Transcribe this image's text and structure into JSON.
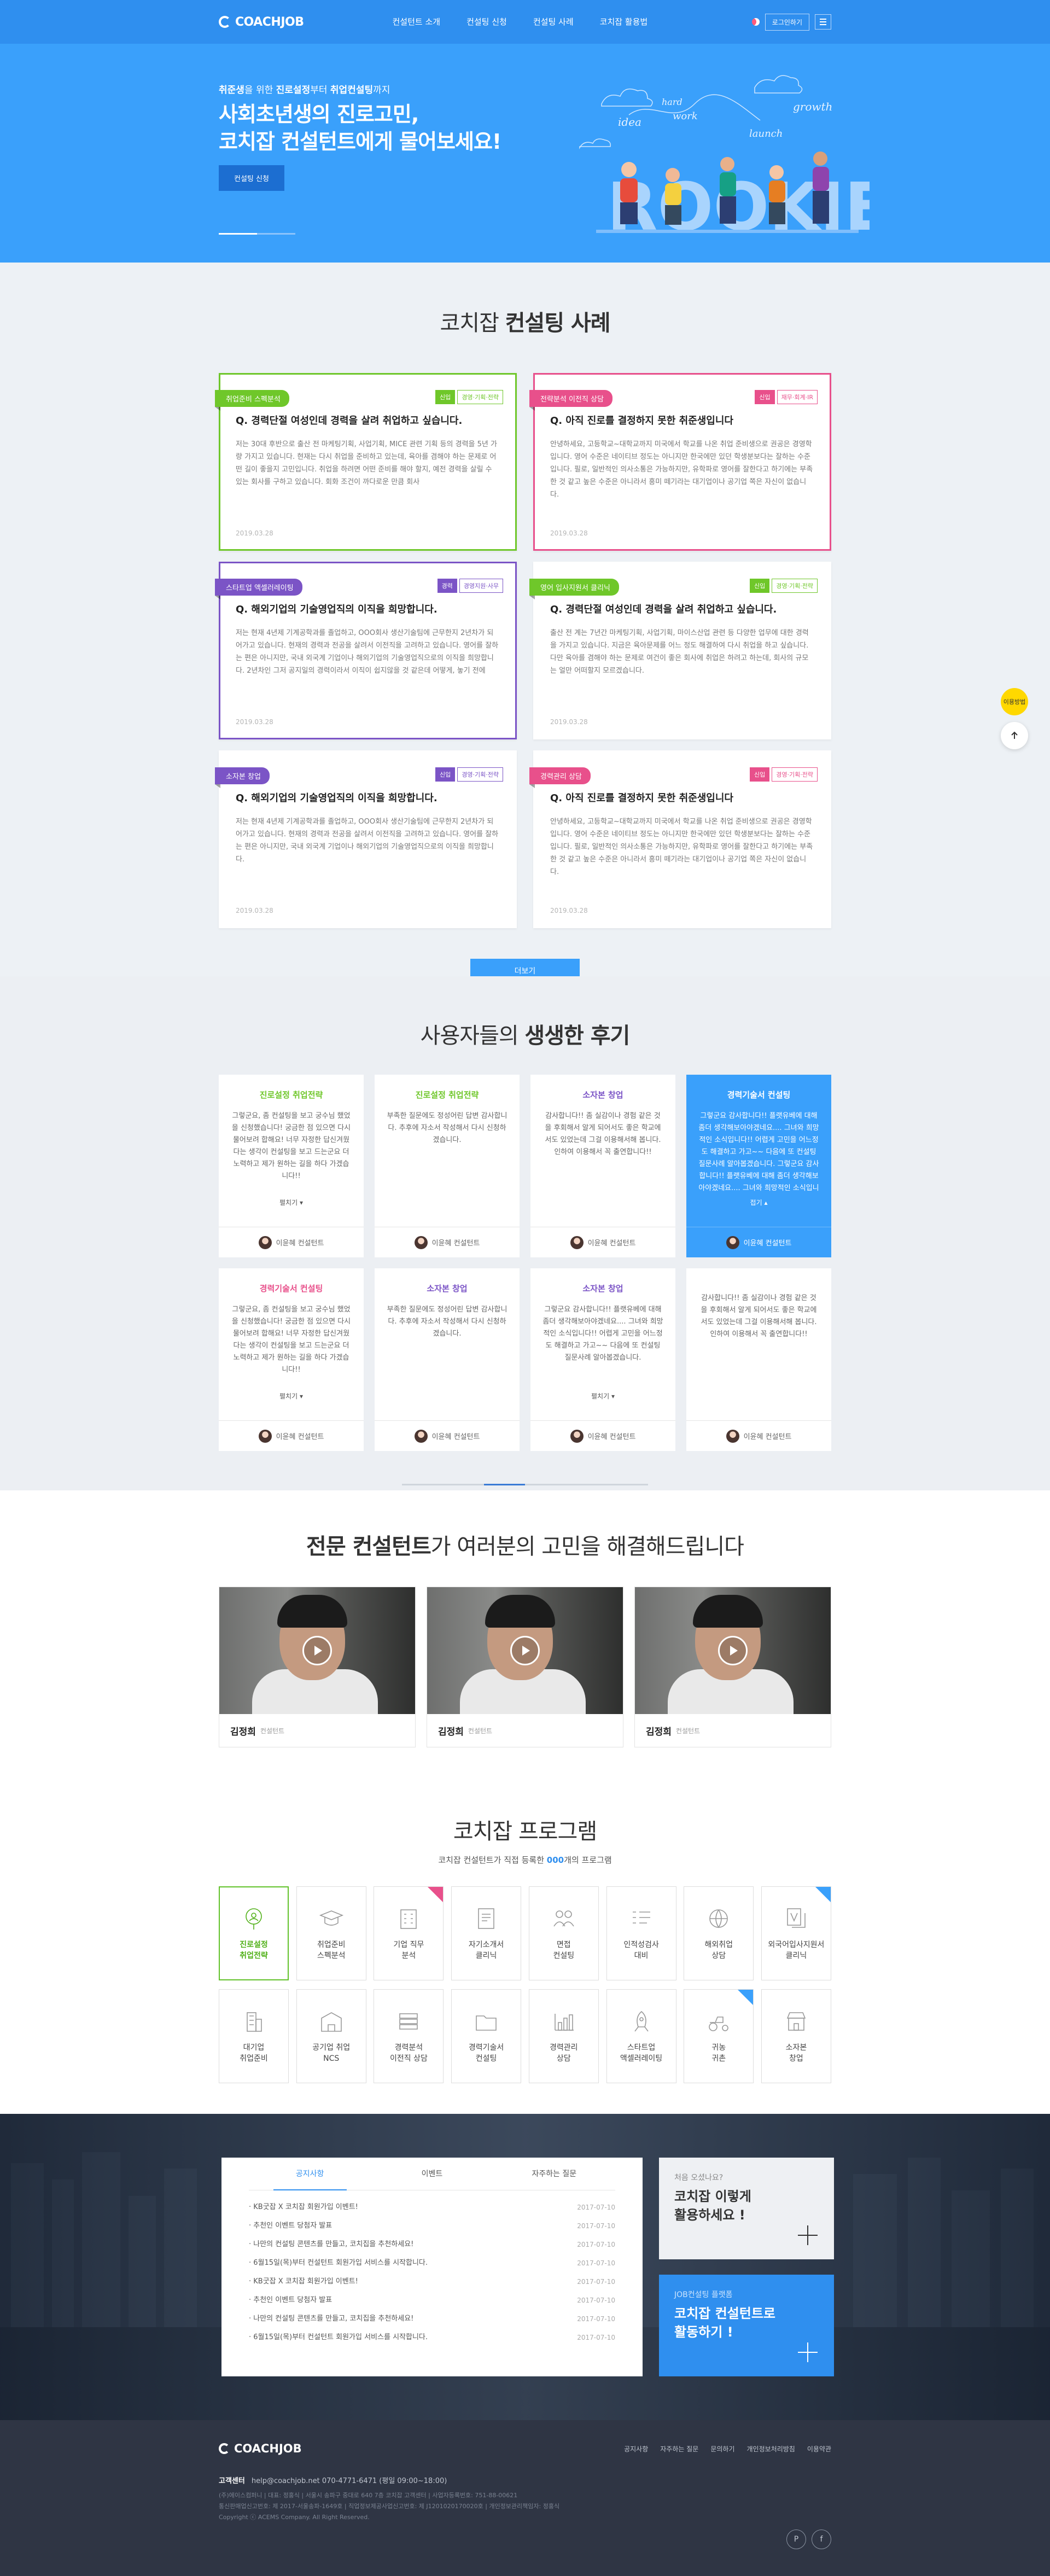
{
  "header": {
    "logo": "COACHJOB",
    "nav": [
      "컨설턴트 소개",
      "컨설팅 신청",
      "컨설팅 사례",
      "코치잡 활용법"
    ],
    "login": "로그인하기"
  },
  "hero": {
    "sub_pre": "취준생",
    "sub_mid1": "을 위한 ",
    "sub_b2": "진로설정",
    "sub_mid2": "부터 ",
    "sub_b3": "취업컨설팅",
    "sub_post": "까지",
    "title_line1": "사회초년생의 진로고민,",
    "title_line2": "코치잡 컨설턴트에게 물어보세요!",
    "button": "컨설팅 신청",
    "art_words": [
      "idea",
      "hard",
      "work",
      "growth",
      "launch"
    ],
    "art_big": "ROOKIE",
    "slide_active": 1,
    "slide_count": 3
  },
  "cases": {
    "title_pre": "코치잡 ",
    "title_b": "컨설팅 사례",
    "more": "더보기",
    "items": [
      {
        "tag": "취업준비 스펙분석",
        "color": "green",
        "bordered": true,
        "badges": [
          "신입",
          "경영·기획·전략"
        ],
        "q": "Q. 경력단절 여성인데 경력을 살려 취업하고 싶습니다.",
        "body": "저는 30대 후반으로 출산 전 마케팅기획, 사업기획, MICE 관련 기획 등의 경력을 5년 가량 가지고 있습니다. 현재는 다시 취업을 준비하고 있는데, 육아를 겸해야 하는 문제로 어떤 길이 좋을지 고민입니다. 취업을 하려면 어떤 준비를 해야 할지, 예전 경력을 살릴 수 있는 회사를 구하고 있습니다. 회화 조건이 까다로운 만큼 회사",
        "date": "2019.03.28"
      },
      {
        "tag": "전략분석 이전직 상담",
        "color": "pink",
        "bordered": true,
        "badges": [
          "신입",
          "재무·회계·IR"
        ],
        "q": "Q. 아직 진로를 결정하지 못한 취준생입니다",
        "body": "안녕하세요, 고등학교~대학교까지 미국에서 학교를 나온 취업 준비생으로 권공은 경영학입니다. 영어 수준은 네이티브 정도는 아니지만 한국에만 있던 학생분보다는 잘하는 수준입니다. 필로, 일반적인 의사소통은 가능하지만, 유학파로 영어를 잘한다고 하기에는 부족한 것 같고 높은 수준은 아니라서 흥미 떼기라는 대기업이나 공기업 쪽은 자신이 없습니다.",
        "date": "2019.03.28"
      },
      {
        "tag": "스타트업 액셀러레이팅",
        "color": "purple",
        "bordered": true,
        "badges": [
          "경력",
          "경영지원·사무"
        ],
        "q": "Q. 해외기업의 기술영업직의 이직을 희망합니다.",
        "body": "저는 현재 4년제 기계공학과를 졸업하고, OOO회사 생산기술팀에 근무한지 2년차가 되어가고 있습니다. 현재의 경력과 전공을 살려서 이전직을 고려하고 있습니다. 영어를 잘하는 편은 아니지만, 국내 외국계 기업이나 해외기업의 기술영업직으로의 이직을 희망합니다. 2년차인 그저 공지일의 경력이라서 이직이 쉽지않을 것 같은데 어떻게, 놓기 전에",
        "date": "2019.03.28"
      },
      {
        "tag": "영어 입사지원서 클리닉",
        "color": "green",
        "bordered": false,
        "badges": [
          "신입",
          "경영·기획·전략"
        ],
        "q": "Q. 경력단절 여성인데 경력을 살려 취업하고 싶습니다.",
        "body": "출산 전 계는 7년간 마케팅기획, 사업기획, 마이스산업 관련 등 다양한 업무에 대한 경력을 가지고 있습니다. 지금은 육아문제를 어느 정도 해결하여 다시 취업을 하고 싶습니다. 다만 육아를 겸해야 하는 문제로 여건이 좋은 회사에 취업은 하려고 하는데, 회사의 규모는 얼만 어떠할지 모르겠습니다.",
        "date": "2019.03.28"
      },
      {
        "tag": "소자본 창업",
        "color": "purple",
        "bordered": false,
        "badges": [
          "신입",
          "경영·기획·전략"
        ],
        "q": "Q. 해외기업의 기술영업직의 이직을 희망합니다.",
        "body": "저는 현재 4년제 기계공학과를 졸업하고, OOO회사 생산기술팀에 근무한지 2년차가 되어가고 있습니다. 현재의 경력과 전공을 살려서 이전직을 고려하고 있습니다. 영어를 잘하는 편은 아니지만, 국내 외국계 기업이나 해외기업의 기술영업직으로의 이직을 희망합니다.",
        "date": "2019.03.28"
      },
      {
        "tag": "경력관리 상담",
        "color": "pink",
        "bordered": false,
        "badges": [
          "신입",
          "경영·기획·전략"
        ],
        "q": "Q. 아직 진로를 결정하지 못한 취준생입니다",
        "body": "안녕하세요, 고등학교~대학교까지 미국에서 학교를 나온 취업 준비생으로 권공은 경영학입니다. 영어 수준은 네이티브 정도는 아니지만 한국에만 있던 학생분보다는 잘하는 수준입니다. 필로, 일반적인 의사소통은 가능하지만, 유학파로 영어를 잘한다고 하기에는 부족한 것 같고 높은 수준은 아니라서 흥미 떼기라는 대기업이나 공기업 쪽은 자신이 없습니다.",
        "date": "2019.03.28"
      }
    ]
  },
  "reviews": {
    "title_pre": "사용자들의 ",
    "title_b": "생생한 후기",
    "items": [
      {
        "tag": "진로설정 취업전략",
        "tcolor": "#6fc72a",
        "text": "그렇군요, 좀 컨설팅을 보고 궁수님 했었을 신청했습니다! 궁금한 점 있으면 다시 물어보려 합해요! 너무 자정한 답신겨웠다는 생각이 컨설팅을 보고 드는군요 더 노력하고 제가 원하는 길을 하다 가겠습니다!!",
        "more": "펼치기",
        "name": "이윤혜 컨설턴트",
        "blue": false
      },
      {
        "tag": "진로설정 취업전략",
        "tcolor": "#6fc72a",
        "text": "부족한 질문에도 정성어린 답변 감사합니다. 추후에 자소서 작성해서 다시 신청하겠습니다.",
        "more": "",
        "name": "이윤혜 컨설턴트",
        "blue": false
      },
      {
        "tag": "소자본 창업",
        "tcolor": "#7b54c6",
        "text": "감사합니다!! 좀 실감이나 경험 같은 것을 후회해서 알게 되어서도 좋은 학교에서도 있었는데 그걸 이용해서해 봅니다. 인하여 이용해서 꼭 출연합니다!!",
        "more": "",
        "name": "이윤혜 컨설턴트",
        "blue": false
      },
      {
        "tag": "경력기술서 컨설팅",
        "tcolor": "#ffffff",
        "text": "그렇군요 감사합니다!! 플랫유베에 대해 좀더 생각해보아야겠네요.... 그녀와 희망적인 소식입니다!! 어렵게 고민을 어느정도 해결하고 가고~~ 다음에 또 컨설팅 질문사례 알아봅겠습니다. 그렇군요 감사합니다!! 플랫유베에 대해 좀더 생각해보아야겠네요.... 그녀와 희망적인 소식입니다!!",
        "more": "접기",
        "name": "이윤혜 컨설턴트",
        "blue": true
      },
      {
        "tag": "경력기술서 컨설팅",
        "tcolor": "#e8508b",
        "text": "그렇군요, 좀 컨설팅을 보고 궁수님 했었을 신청했습니다! 궁금한 점 있으면 다시 물어보려 합해요! 너무 자정한 답신겨웠다는 생각이 컨설팅을 보고 드는군요 더 노력하고 제가 원하는 길을 하다 가겠습니다!!",
        "more": "펼치기",
        "name": "이윤혜 컨설턴트",
        "blue": false
      },
      {
        "tag": "소자본 창업",
        "tcolor": "#7b54c6",
        "text": "부족한 질문에도 정성어린 답변 감사합니다. 추후에 자소서 작성해서 다시 신청하겠습니다.",
        "more": "",
        "name": "이윤혜 컨설턴트",
        "blue": false
      },
      {
        "tag": "소자본 창업",
        "tcolor": "#7b54c6",
        "text": "그렇군요 감사합니다!! 플랫유베에 대해 좀더 생각해보아야겠네요.... 그녀와 희망적인 소식입니다!! 어렵게 고민을 어느정도 해결하고 가고~~ 다음에 또 컨설팅 질문사례 알아봅겠습니다.",
        "more": "펼치기",
        "name": "이윤혜 컨설턴트",
        "blue": false
      },
      {
        "tag": "",
        "tcolor": "#333333",
        "text": "감사합니다!! 좀 실감이나 경험 같은 것을 후회해서 알게 되어서도 좋은 학교에서도 있었는데 그걸 이용해서해 봅니다. 인하여 이용해서 꼭 출연합니다!!",
        "more": "",
        "name": "이윤혜 컨설턴트",
        "blue": false
      }
    ],
    "slide_active": 3,
    "slide_count": 6
  },
  "consultants": {
    "title_pre": "전문 컨설턴트",
    "title_post": "가 여러분의 고민을 해결해드립니다",
    "items": [
      {
        "name": "김정희",
        "role": "컨설턴트"
      },
      {
        "name": "김정희",
        "role": "컨설턴트"
      },
      {
        "name": "김정희",
        "role": "컨설턴트"
      }
    ]
  },
  "programs": {
    "title": "코치잡 프로그램",
    "sub_pre": "코치잡 컨설턴트가 직접 등록한 ",
    "sub_b": "000",
    "sub_post": "개의 프로그램",
    "items": [
      {
        "label": "진로설정\n취업전략",
        "icon": "compass-icon",
        "on": true,
        "corner": ""
      },
      {
        "label": "취업준비\n스펙분석",
        "icon": "graduation-cap-icon",
        "on": false,
        "corner": ""
      },
      {
        "label": "기업 직무\n분석",
        "icon": "building-icon",
        "on": false,
        "corner": "#e8508b"
      },
      {
        "label": "자기소개서\n클리닉",
        "icon": "document-icon",
        "on": false,
        "corner": ""
      },
      {
        "label": "면접\n컨설팅",
        "icon": "people-icon",
        "on": false,
        "corner": ""
      },
      {
        "label": "인적성검사\n대비",
        "icon": "checklist-icon",
        "on": false,
        "corner": ""
      },
      {
        "label": "해외취업\n상담",
        "icon": "globe-icon",
        "on": false,
        "corner": ""
      },
      {
        "label": "외국어입사지원서\n클리닉",
        "icon": "translate-icon",
        "on": false,
        "corner": "#3aa0fb"
      },
      {
        "label": "대기업\n취업준비",
        "icon": "tower-icon",
        "on": false,
        "corner": ""
      },
      {
        "label": "공기업 취업\nNCS",
        "icon": "office-icon",
        "on": false,
        "corner": ""
      },
      {
        "label": "경력분석\n이전직 상담",
        "icon": "stack-icon",
        "on": false,
        "corner": ""
      },
      {
        "label": "경력기술서\n컨설팅",
        "icon": "folder-icon",
        "on": false,
        "corner": ""
      },
      {
        "label": "경력관리\n상담",
        "icon": "chart-icon",
        "on": false,
        "corner": ""
      },
      {
        "label": "스타트업\n액셀러레이팅",
        "icon": "rocket-icon",
        "on": false,
        "corner": ""
      },
      {
        "label": "귀농\n귀촌",
        "icon": "tractor-icon",
        "on": false,
        "corner": "#3aa0fb"
      },
      {
        "label": "소자본\n창업",
        "icon": "shop-icon",
        "on": false,
        "corner": ""
      }
    ]
  },
  "notice": {
    "tabs": [
      "공지사항",
      "이벤트",
      "자주하는 질문"
    ],
    "active_tab": 0,
    "items": [
      {
        "t": "KB굿잡 X 코치잡 회원가입 이벤트!",
        "d": "2017-07-10"
      },
      {
        "t": "추천인 이벤트 당첨자 발표",
        "d": "2017-07-10"
      },
      {
        "t": "나만의 컨설팅 콘텐츠를 만들고, 코치집을 추천하세요!",
        "d": "2017-07-10"
      },
      {
        "t": "6월15일(목)부터 컨설턴트 회원가입 서비스를 시작합니다.",
        "d": "2017-07-10"
      },
      {
        "t": "KB굿잡 X 코치잡 회원가입 이벤트!",
        "d": "2017-07-10"
      },
      {
        "t": "추천인 이벤트 당첨자 발표",
        "d": "2017-07-10"
      },
      {
        "t": "나만의 컨설팅 콘텐츠를 만들고, 코치집을 추천하세요!",
        "d": "2017-07-10"
      },
      {
        "t": "6월15일(목)부터 컨설턴트 회원가입 서비스를 시작합니다.",
        "d": "2017-07-10"
      }
    ],
    "side1_s1": "처음 오셨나요?",
    "side1_s2": "코치잡 이렇게\n활용하세요 !",
    "side2_s1": "JOB컨설팅 플랫폼",
    "side2_s2": "코치잡 컨설턴트로\n활동하기 !"
  },
  "footer": {
    "logo": "COACHJOB",
    "links": [
      "공지사항",
      "자주하는 질문",
      "문의하기",
      "개인정보처리방침",
      "이용약관"
    ],
    "cs_label": "고객센터",
    "cs_text": "help@coachjob.net     070-4771-6471 (평일 09:00~18:00)",
    "info_line1": "(주)에이스컴퍼니   |   대표: 정홍식   |   서울시 송파구 중대로 640 7층 코치잡 고객센터   |   사업자등록번호: 751-88-00621",
    "info_line2": "통신판매업신고번호: 제 2017-서울송파-1649호   |   직업정보제공사업신고번호: 제 J1201020170020호   |   개인정보관리책임자: 정홍식",
    "info_line3": "Copyright ⓒ ACEMS Company. All Right Reserved.",
    "sns": [
      "P",
      "f"
    ]
  },
  "floating": {
    "badge": "이용방법"
  }
}
